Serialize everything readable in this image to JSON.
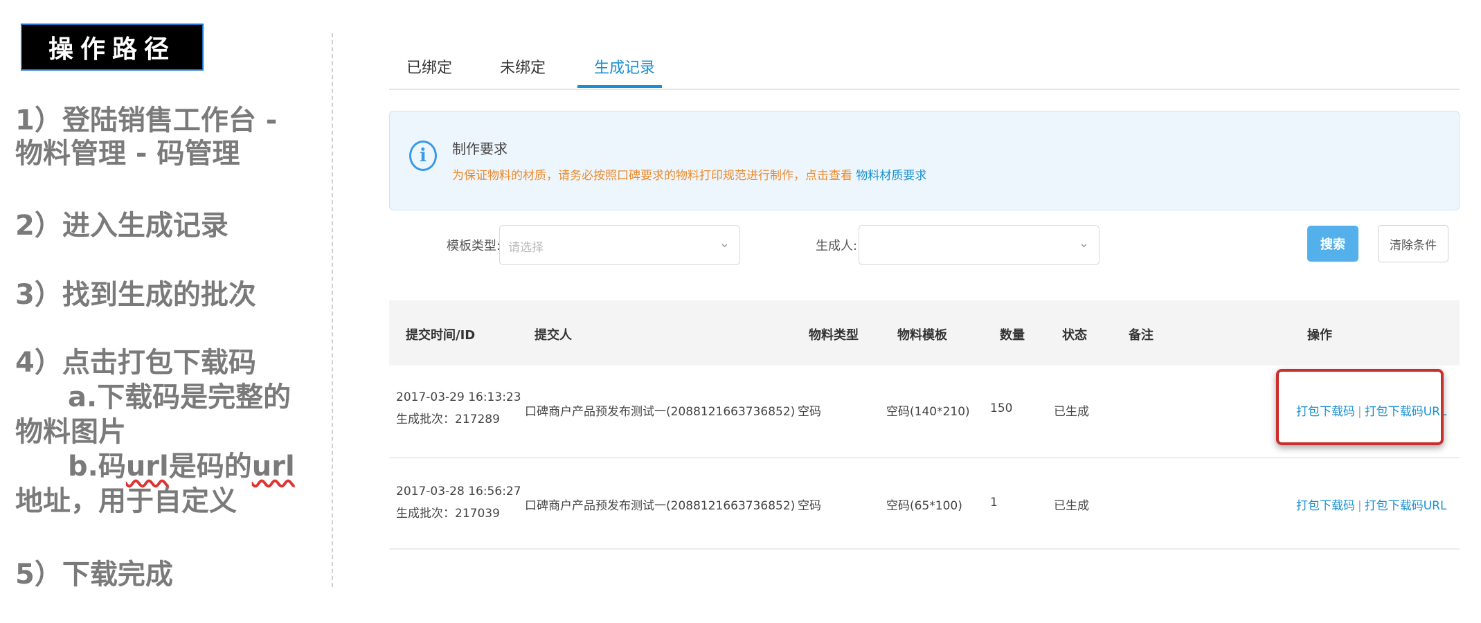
{
  "guide": {
    "title": "操作路径",
    "steps": {
      "s1_l1": "1）登陆销售工作台 -",
      "s1_l2": "物料管理 - 码管理",
      "s2": "2）进入生成记录",
      "s3": "3）找到生成的批次",
      "s4_l1": "4）点击打包下载码",
      "s4_l2": "a.下载码是完整的",
      "s4_l3": "物料图片",
      "s4_l4_pre": "b.码",
      "s4_l4_url": "url",
      "s4_l4_mid": "是码的",
      "s4_l4_url2": "url",
      "s4_l5": "地址，用于自定义",
      "s5": "5）下载完成"
    }
  },
  "tabs": [
    {
      "label": "已绑定",
      "active": false
    },
    {
      "label": "未绑定",
      "active": false
    },
    {
      "label": "生成记录",
      "active": true
    }
  ],
  "notice": {
    "icon": "info-circle-icon",
    "title": "制作要求",
    "text": "为保证物料的材质，请务必按照口碑要求的物料打印规范进行制作，点击查看 ",
    "link": "物料材质要求"
  },
  "filters": {
    "template_label": "模板类型:",
    "template_placeholder": "请选择",
    "creator_label": "生成人:",
    "creator_value": "",
    "search_button": "搜索",
    "clear_button": "清除条件"
  },
  "table": {
    "columns": [
      "提交时间/ID",
      "提交人",
      "物料类型",
      "物料模板",
      "数量",
      "状态",
      "备注",
      "操作"
    ],
    "rows": [
      {
        "time": "2017-03-29 16:13:23",
        "batch": "生成批次：217289",
        "submitter": "口碑商户产品预发布测试一(2088121663736852)",
        "type": "空码",
        "template": "空码(140*210)",
        "quantity": "150",
        "status": "已生成",
        "remark": "",
        "op1": "打包下载码",
        "op2": "打包下载码URL"
      },
      {
        "time": "2017-03-28 16:56:27",
        "batch": "生成批次：217039",
        "submitter": "口碑商户产品预发布测试一(2088121663736852)",
        "type": "空码",
        "template": "空码(65*100)",
        "quantity": "1",
        "status": "已生成",
        "remark": "",
        "op1": "打包下载码",
        "op2": "打包下载码URL"
      }
    ]
  },
  "colors": {
    "accent": "#1890d0",
    "warning_text": "#ec8a2a",
    "highlight": "#c9302c"
  }
}
